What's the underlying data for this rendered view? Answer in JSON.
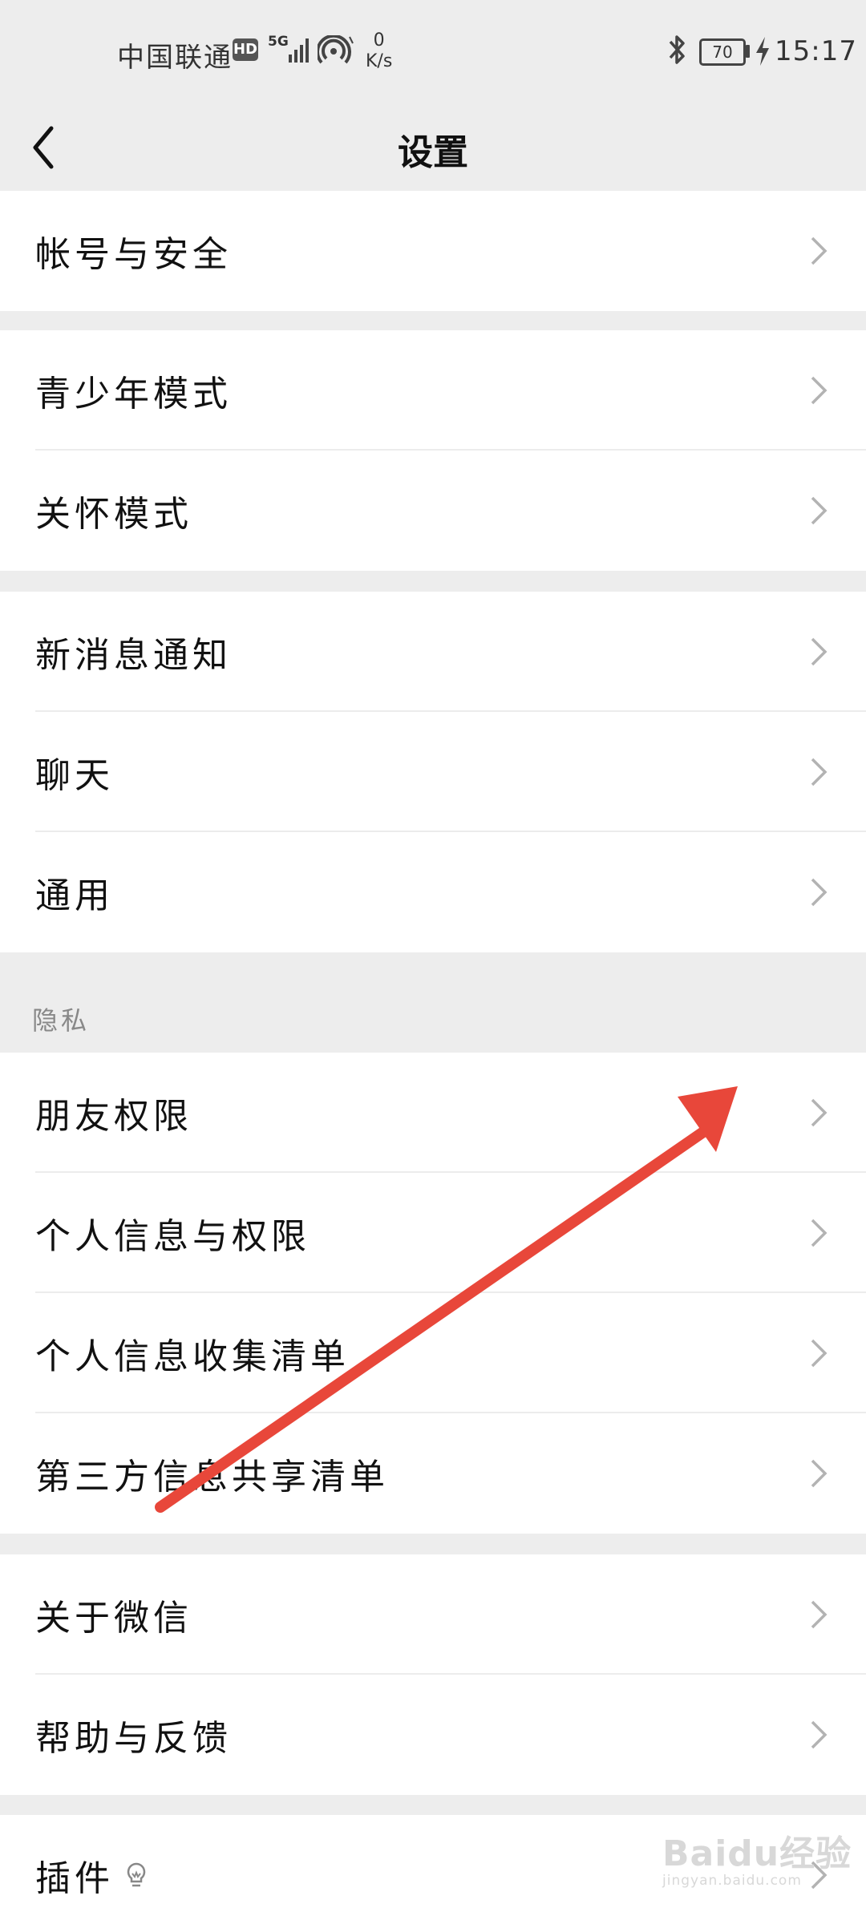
{
  "status_bar": {
    "carrier": "中国联通",
    "hd_badge": "HD",
    "network": "5G",
    "speed_value": "0",
    "speed_unit": "K/s",
    "battery": "70",
    "time": "15:17",
    "icons": [
      "hd-icon",
      "signal-icon",
      "hotspot-icon",
      "bluetooth-icon",
      "battery-icon",
      "charging-icon"
    ]
  },
  "header": {
    "title": "设置",
    "back_icon": "chevron-left-icon"
  },
  "groups": {
    "account": {
      "items": [
        "帐号与安全"
      ]
    },
    "modes": {
      "items": [
        "青少年模式",
        "关怀模式"
      ]
    },
    "general": {
      "items": [
        "新消息通知",
        "聊天",
        "通用"
      ]
    },
    "privacy": {
      "title": "隐私",
      "items": [
        "朋友权限",
        "个人信息与权限",
        "个人信息收集清单",
        "第三方信息共享清单"
      ]
    },
    "about": {
      "items": [
        "关于微信",
        "帮助与反馈"
      ]
    },
    "plugins": {
      "items": [
        "插件"
      ],
      "icon": "lightbulb-icon"
    }
  },
  "annotation": {
    "color": "#e8473a"
  },
  "watermark": {
    "main": "Baidu经验",
    "sub": "jingyan.baidu.com"
  },
  "colors": {
    "background": "#ededed",
    "card": "#ffffff",
    "chevron": "#b3b3b3"
  }
}
